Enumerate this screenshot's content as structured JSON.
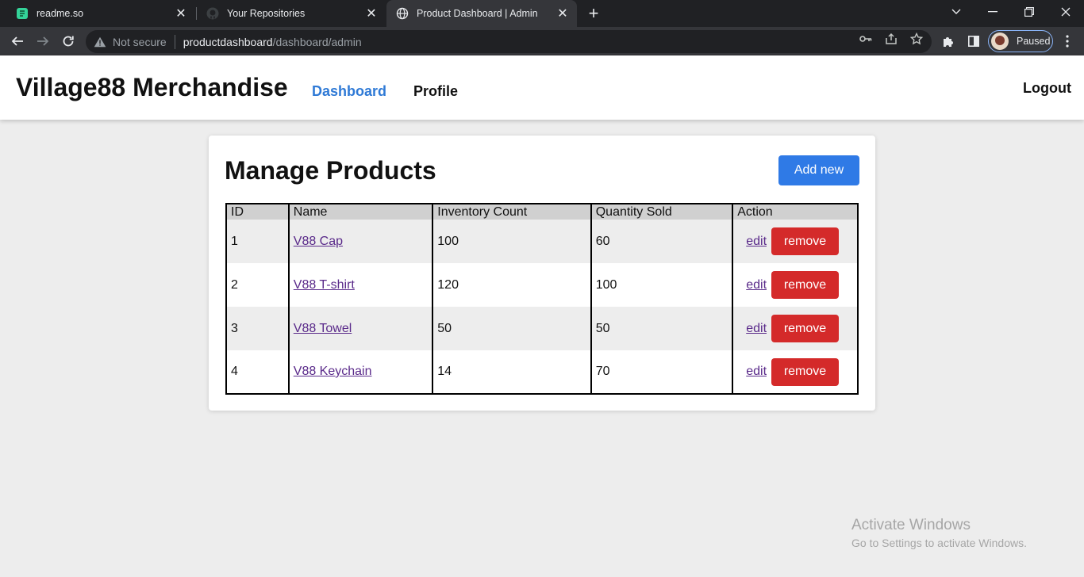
{
  "browser": {
    "tabs": [
      {
        "title": "readme.so",
        "favicon": "readme-so-icon",
        "active": false
      },
      {
        "title": "Your Repositories",
        "favicon": "github-icon",
        "active": false
      },
      {
        "title": "Product Dashboard | Admin",
        "favicon": "globe-icon",
        "active": true
      }
    ],
    "security_label": "Not secure",
    "url_host": "productdashboard",
    "url_path": "/dashboard/admin",
    "profile_status": "Paused"
  },
  "header": {
    "brand": "Village88 Merchandise",
    "nav": {
      "dashboard": "Dashboard",
      "profile": "Profile"
    },
    "logout": "Logout",
    "active_color": "#2f7ad6"
  },
  "main": {
    "title": "Manage Products",
    "add_button": "Add new",
    "table": {
      "columns": [
        "ID",
        "Name",
        "Inventory Count",
        "Quantity Sold",
        "Action"
      ],
      "rows": [
        {
          "id": "1",
          "name": "V88 Cap",
          "inventory": "100",
          "sold": "60",
          "edit": "edit",
          "remove": "remove"
        },
        {
          "id": "2",
          "name": "V88 T-shirt",
          "inventory": "120",
          "sold": "100",
          "edit": "edit",
          "remove": "remove"
        },
        {
          "id": "3",
          "name": "V88 Towel",
          "inventory": "50",
          "sold": "50",
          "edit": "edit",
          "remove": "remove"
        },
        {
          "id": "4",
          "name": "V88 Keychain",
          "inventory": "14",
          "sold": "70",
          "edit": "edit",
          "remove": "remove"
        }
      ]
    },
    "colors": {
      "primary": "#2f7ae6",
      "danger": "#d42a2a",
      "link": "#5a2a8a"
    }
  },
  "watermark": {
    "line1": "Activate Windows",
    "line2": "Go to Settings to activate Windows."
  }
}
